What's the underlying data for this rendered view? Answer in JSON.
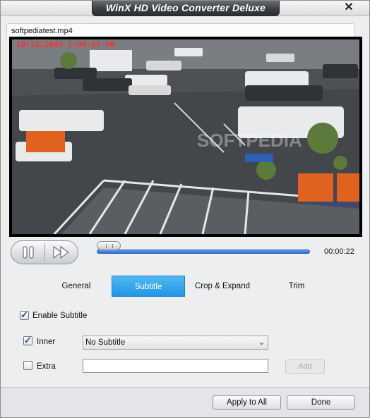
{
  "window": {
    "title": "WinX HD Video Converter Deluxe",
    "close_glyph": "✕"
  },
  "file_tab": {
    "filename": "softpediatest.mp4"
  },
  "preview": {
    "timestamp": "10/15/2007 1:00:07 PM"
  },
  "playback": {
    "elapsed": "00:00:22",
    "pause_icon": "pause-icon",
    "forward_icon": "fast-forward-icon",
    "seek_fraction": 0.05
  },
  "tabs": [
    {
      "label": "General",
      "active": false
    },
    {
      "label": "Subtitle",
      "active": true
    },
    {
      "label": "Crop & Expand",
      "active": false
    },
    {
      "label": "Trim",
      "active": false
    }
  ],
  "subtitle": {
    "enable_label": "Enable Subtitle",
    "enable_checked": true,
    "inner_label": "Inner",
    "inner_checked": true,
    "inner_value": "No Subtitle",
    "extra_label": "Extra",
    "extra_checked": false,
    "extra_value": "",
    "add_label": "Add"
  },
  "footer": {
    "apply_all_label": "Apply to All",
    "done_label": "Done"
  },
  "colors": {
    "accent_tab": "#2196e6",
    "seek_bar": "#2c6fd0",
    "timestamp": "#ff2b2b"
  }
}
